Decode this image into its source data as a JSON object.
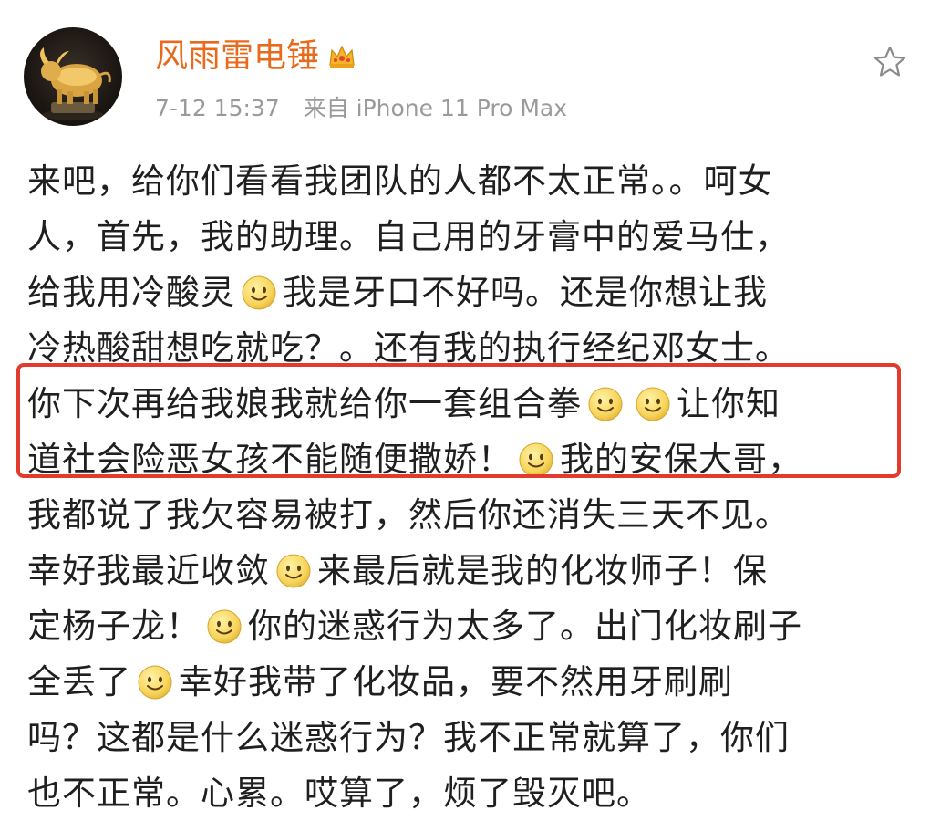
{
  "post": {
    "username": "风雨雷电锤",
    "badge_icon": "crown-icon",
    "timestamp": "7-12 15:37",
    "source": "来自 iPhone 11 Pro Max",
    "favorite_icon": "star-icon",
    "emoji_icon": "smile-emoji-icon",
    "colors": {
      "username": "#e86a1c",
      "meta": "#9a9a9a",
      "highlight": "#e23b2e"
    },
    "lines": [
      {
        "segments": [
          {
            "t": "来吧，给你们看看我团队的人都不太正常。。呵女"
          }
        ]
      },
      {
        "segments": [
          {
            "t": "人，首先，我的助理。自己用的牙膏中的爱马仕，"
          }
        ]
      },
      {
        "segments": [
          {
            "t": "给我用冷酸灵"
          },
          {
            "emoji": true
          },
          {
            "t": "我是牙口不好吗。还是你想让我"
          }
        ]
      },
      {
        "segments": [
          {
            "t": "冷热酸甜想吃就吃？。还有我的执行经纪邓女士。"
          }
        ]
      },
      {
        "segments": [
          {
            "t": "你下次再给我娘我就给你一套组合拳"
          },
          {
            "emoji": true
          },
          {
            "emoji": true
          },
          {
            "t": "让你知"
          }
        ]
      },
      {
        "segments": [
          {
            "t": "道社会险恶女孩不能随便撒娇！"
          },
          {
            "emoji": true
          },
          {
            "t": "我的安保大哥，"
          }
        ]
      },
      {
        "segments": [
          {
            "t": "我都说了我欠容易被打，然后你还消失三天不见。"
          }
        ]
      },
      {
        "segments": [
          {
            "t": "幸好我最近收敛"
          },
          {
            "emoji": true
          },
          {
            "t": "来最后就是我的化妆师子！保"
          }
        ]
      },
      {
        "segments": [
          {
            "t": "定杨子龙！"
          },
          {
            "emoji": true
          },
          {
            "t": "你的迷惑行为太多了。出门化妆刷子"
          }
        ]
      },
      {
        "segments": [
          {
            "t": "全丢了"
          },
          {
            "emoji": true
          },
          {
            "t": "幸好我带了化妆品，要不然用牙刷刷"
          }
        ]
      },
      {
        "segments": [
          {
            "t": "吗？这都是什么迷惑行为？我不正常就算了，你们"
          }
        ]
      },
      {
        "segments": [
          {
            "t": "也不正常。心累。哎算了，烦了毁灭吧。"
          }
        ]
      }
    ],
    "highlighted_lines": [
      4,
      5
    ]
  }
}
